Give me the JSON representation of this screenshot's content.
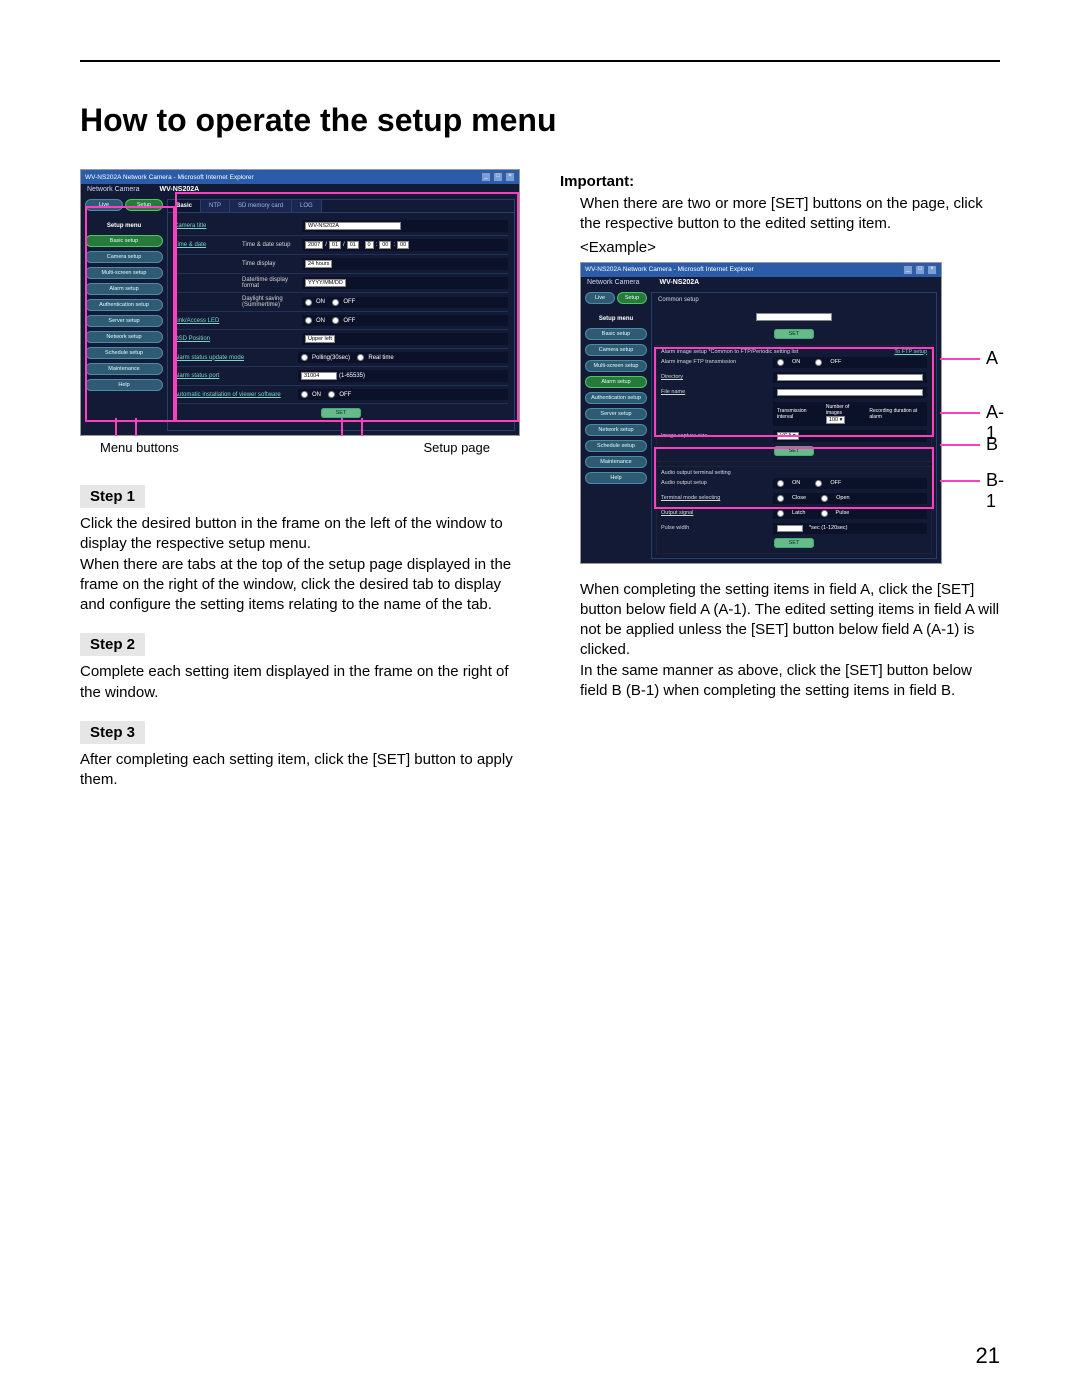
{
  "page": {
    "title": "How to operate the setup menu",
    "number": "21"
  },
  "screenshot1": {
    "browser_title": "WV-NS202A Network Camera - Microsoft Internet Explorer",
    "model_label": "Network Camera",
    "model": "WV-NS202A",
    "top_buttons": {
      "live": "Live",
      "setup": "Setup"
    },
    "sidebar_header": "Setup menu",
    "sidebar": [
      "Basic setup",
      "Camera setup",
      "Multi-screen setup",
      "Alarm setup",
      "Authentication setup",
      "Server setup",
      "Network setup",
      "Schedule setup",
      "Maintenance",
      "Help"
    ],
    "tabs": [
      "Basic",
      "NTP",
      "SD memory card",
      "LOG"
    ],
    "form": {
      "camera_title": {
        "label": "Camera title",
        "value": "WV-NS202A"
      },
      "time_date": {
        "group": "Time & date",
        "row_setup": {
          "label": "Time & date setup",
          "y": "2007",
          "mo": "01",
          "d": "01",
          "h": "0",
          "mi": "00",
          "s": "00"
        },
        "row_disp": {
          "label": "Time display",
          "value": "24 hours"
        },
        "row_fmt": {
          "label": "Date/time display format",
          "value": "YYYY/MM/DD"
        },
        "row_dst": {
          "label": "Daylight saving (Summertime)",
          "on": "ON",
          "off": "OFF"
        }
      },
      "led": {
        "label": "Link/Access LED",
        "on": "ON",
        "off": "OFF"
      },
      "osd": {
        "label": "OSD Position",
        "value": "Upper left"
      },
      "upd_mode": {
        "label": "Alarm status update mode",
        "p": "Polling(30sec)",
        "r": "Real time"
      },
      "upd_port": {
        "label": "Alarm status port",
        "value": "31004",
        "range": "(1-65535)"
      },
      "auto_inst": {
        "label": "Automatic installation of viewer software",
        "on": "ON",
        "off": "OFF"
      },
      "set_btn": "SET"
    },
    "labels": {
      "left": "Menu buttons",
      "right": "Setup page"
    }
  },
  "left_column": {
    "step1_label": "Step 1",
    "step1_text": "Click the desired button in the frame on the left of the window to display the respective setup menu.\nWhen there are tabs at the top of the setup page displayed in the frame on the right of the window, click the desired tab to display and configure the setting items relating to the name of the tab.",
    "step2_label": "Step 2",
    "step2_text": "Complete each setting item displayed in the frame on the right of the window.",
    "step3_label": "Step 3",
    "step3_text": "After completing each setting item, click the [SET] button to apply them."
  },
  "right_column": {
    "important_label": "Important:",
    "important_text": "When there are two or more [SET] buttons on the page, click the respective button to the edited setting item.",
    "example_label": "<Example>",
    "after_text": "When completing the setting items in field A, click the [SET] button below field A (A-1). The edited setting items in field A will not be applied unless the [SET] button below field A (A-1) is clicked.\nIn the same manner as above, click the [SET] button below field B (B-1) when completing the setting items in field B."
  },
  "screenshot2": {
    "browser_title": "WV-NS202A Network Camera - Microsoft Internet Explorer",
    "model": "WV-NS202A",
    "panel_title": "Common setup",
    "top_set": "SET",
    "sectionA": {
      "heading": "Alarm image setup  *Common to FTP/Periodic setting list",
      "link": "To FTP setup",
      "row1": {
        "label": "Alarm image FTP transmission",
        "on": "ON",
        "off": "OFF"
      },
      "row2": {
        "label": "Directory",
        "value": ""
      },
      "row3": {
        "label": "File name",
        "value": ""
      },
      "row4": {
        "label": "",
        "c1": "Transmission interval",
        "c2": "Number of images",
        "c2v": "100 ▾",
        "c3": "Recording duration at alarm"
      },
      "row5": {
        "label": "Image capture size",
        "value": "VGA ▾"
      },
      "set": "SET"
    },
    "sectionB": {
      "heading": "Audio output terminal setting",
      "row1": {
        "label": "Audio output setup",
        "on": "ON",
        "off": "OFF"
      },
      "row2": {
        "label": "Terminal mode selecting",
        "a": "Close",
        "b": "Open"
      },
      "row3": {
        "label": "Output signal",
        "a": "Latch",
        "b": "Pulse"
      },
      "row4": {
        "label": "Pulse width",
        "value": "",
        "unit": "*sec (1-120sec)"
      },
      "set": "SET"
    },
    "annotations": {
      "A": "A",
      "A1": "A-1",
      "B": "B",
      "B1": "B-1"
    }
  }
}
